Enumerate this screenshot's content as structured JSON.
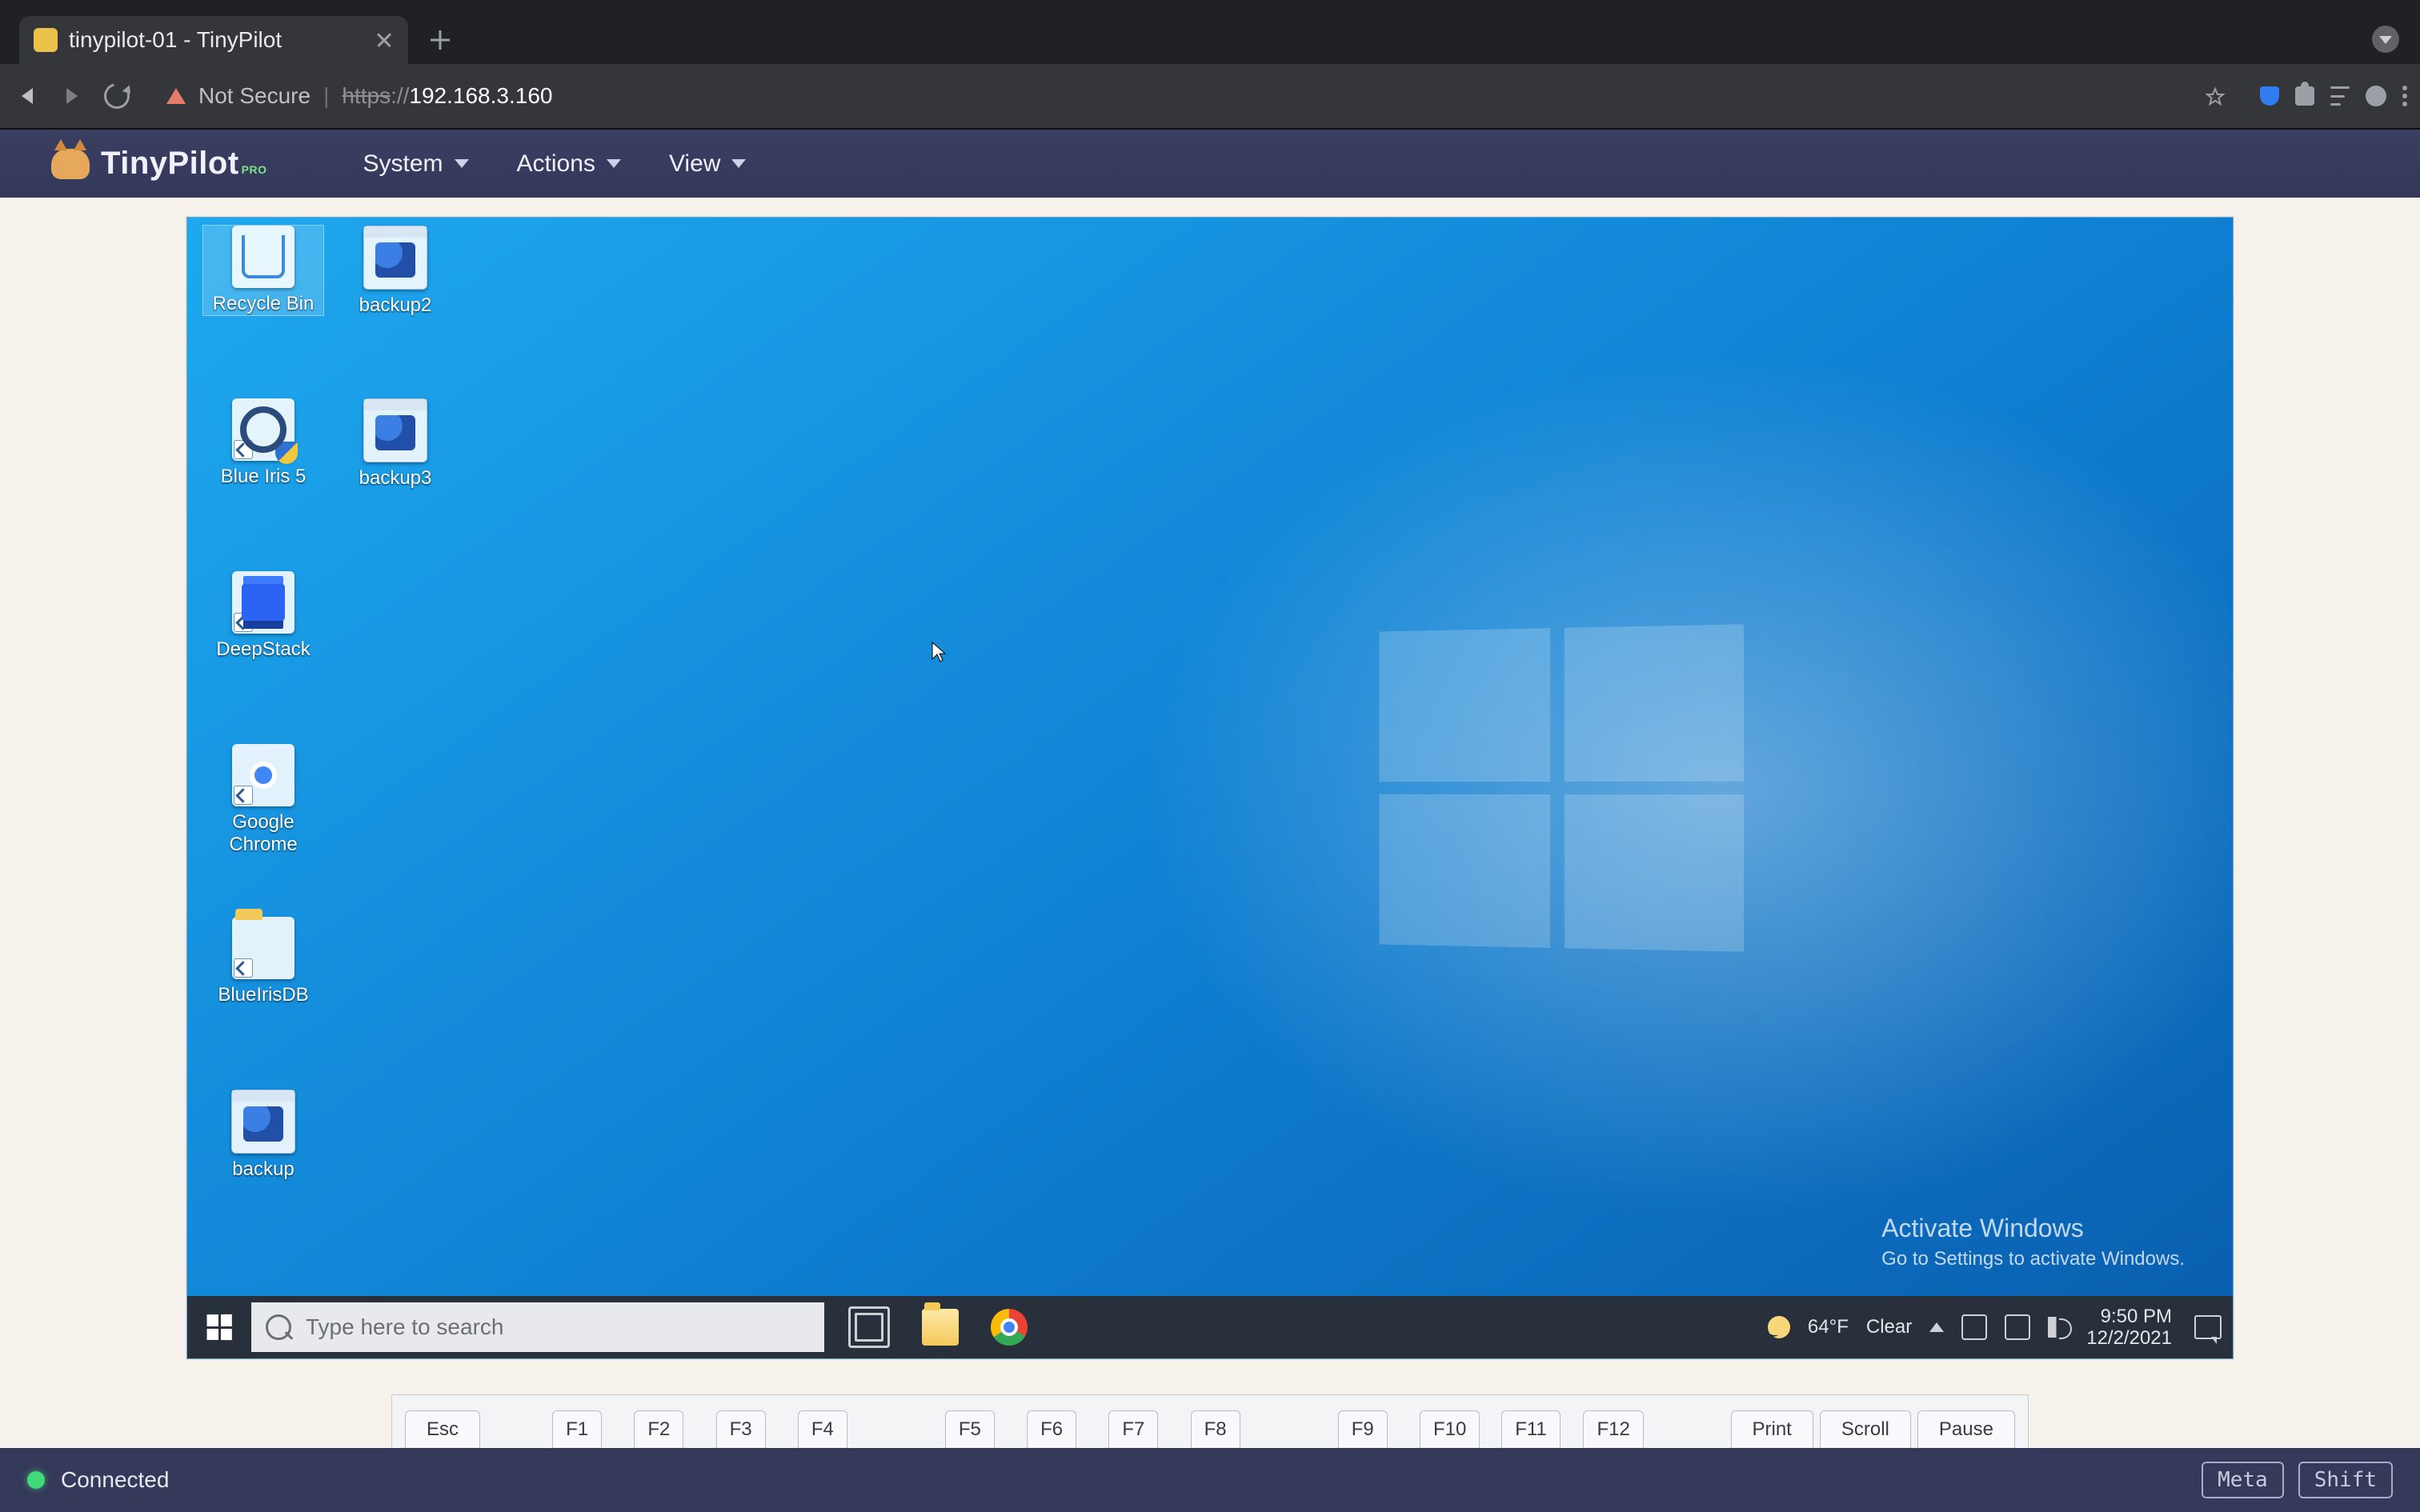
{
  "browser": {
    "tab_title": "tinypilot-01 - TinyPilot",
    "not_secure_label": "Not Secure",
    "url_protocol": "https",
    "url_protocol_suffix": "://",
    "url_host": "192.168.3.160"
  },
  "tinypilot": {
    "brand": "TinyPilot",
    "brand_badge": "PRO",
    "menus": {
      "system": "System",
      "actions": "Actions",
      "view": "View"
    }
  },
  "remote": {
    "desktop_icons": [
      {
        "id": "recycle-bin",
        "label": "Recycle Bin",
        "kind": "bin",
        "col": 0,
        "row": 0,
        "selected": true,
        "shortcut": false
      },
      {
        "id": "backup2",
        "label": "backup2",
        "kind": "reg",
        "col": 1,
        "row": 0,
        "selected": false,
        "shortcut": false
      },
      {
        "id": "blue-iris-5",
        "label": "Blue Iris 5",
        "kind": "mag",
        "col": 0,
        "row": 1,
        "selected": false,
        "shortcut": true,
        "shield": true
      },
      {
        "id": "backup3",
        "label": "backup3",
        "kind": "reg",
        "col": 1,
        "row": 1,
        "selected": false,
        "shortcut": false
      },
      {
        "id": "deepstack",
        "label": "DeepStack",
        "kind": "deepstack",
        "col": 0,
        "row": 2,
        "selected": false,
        "shortcut": true
      },
      {
        "id": "google-chrome",
        "label": "Google Chrome",
        "kind": "chrome",
        "col": 0,
        "row": 3,
        "selected": false,
        "shortcut": true
      },
      {
        "id": "blueirisdb",
        "label": "BlueIrisDB",
        "kind": "folder",
        "col": 0,
        "row": 4,
        "selected": false,
        "shortcut": true
      },
      {
        "id": "backup",
        "label": "backup",
        "kind": "reg",
        "col": 0,
        "row": 5,
        "selected": false,
        "shortcut": false
      }
    ],
    "activate": {
      "line1": "Activate Windows",
      "line2": "Go to Settings to activate Windows."
    },
    "taskbar": {
      "search_placeholder": "Type here to search",
      "weather_temp": "64°F",
      "weather_cond": "Clear",
      "time": "9:50 PM",
      "date": "12/2/2021"
    }
  },
  "keyboard_row": [
    "Esc",
    "F1",
    "F2",
    "F3",
    "F4",
    "F5",
    "F6",
    "F7",
    "F8",
    "F9",
    "F10",
    "F11",
    "F12",
    "Print",
    "Scroll",
    "Pause"
  ],
  "statusbar": {
    "status_text": "Connected",
    "pill_meta": "Meta",
    "pill_shift": "Shift"
  }
}
